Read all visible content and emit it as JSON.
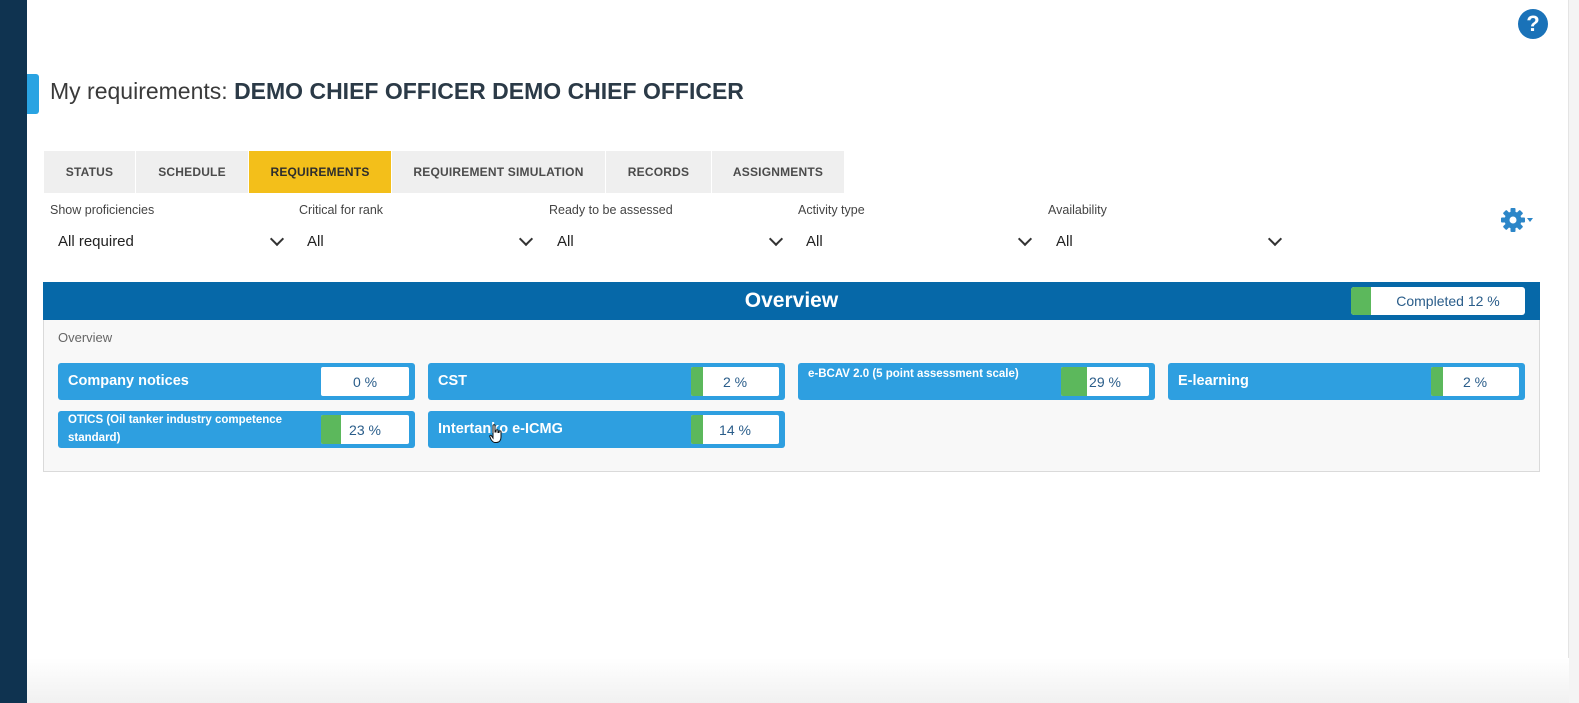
{
  "page": {
    "title_prefix": "My requirements: ",
    "title_owner": "DEMO CHIEF OFFICER DEMO CHIEF OFFICER",
    "help_icon": "?"
  },
  "tabs": [
    {
      "label": "STATUS",
      "active": false
    },
    {
      "label": "SCHEDULE",
      "active": false
    },
    {
      "label": "REQUIREMENTS",
      "active": true
    },
    {
      "label": "REQUIREMENT SIMULATION",
      "active": false
    },
    {
      "label": "RECORDS",
      "active": false
    },
    {
      "label": "ASSIGNMENTS",
      "active": false
    }
  ],
  "filters": [
    {
      "label": "Show proficiencies",
      "value": "All required"
    },
    {
      "label": "Critical for rank",
      "value": "All"
    },
    {
      "label": "Ready to be assessed",
      "value": "All"
    },
    {
      "label": "Activity type",
      "value": "All"
    },
    {
      "label": "Availability",
      "value": "All"
    }
  ],
  "overview": {
    "title": "Overview",
    "completed_label": "Completed 12 %",
    "completed_fraction": 0.12,
    "subhead": "Overview",
    "cards": [
      {
        "name": "Company notices",
        "percent_label": "0 %",
        "progress": 0.0
      },
      {
        "name": "CST",
        "percent_label": "2 %",
        "progress": 0.02
      },
      {
        "name": "e-BCAV 2.0 (5 point assessment scale)",
        "percent_label": "29 %",
        "progress": 0.29
      },
      {
        "name": "E-learning",
        "percent_label": "2 %",
        "progress": 0.02
      },
      {
        "name": "OTICS (Oil tanker industry competence standard)",
        "percent_label": "23 %",
        "progress": 0.23
      },
      {
        "name": "Intertanko e-ICMG",
        "percent_label": "14 %",
        "progress": 0.14
      }
    ]
  },
  "colors": {
    "accent_blue": "#0668a8",
    "card_blue": "#2e9fe0",
    "active_tab": "#f3bf1a",
    "progress_green": "#5cb85c",
    "rail": "#0f3350"
  },
  "icons": {
    "help": "help-icon",
    "settings": "gear-icon",
    "dropdown": "chevron-down-icon",
    "cursor": "hand-cursor-icon"
  }
}
